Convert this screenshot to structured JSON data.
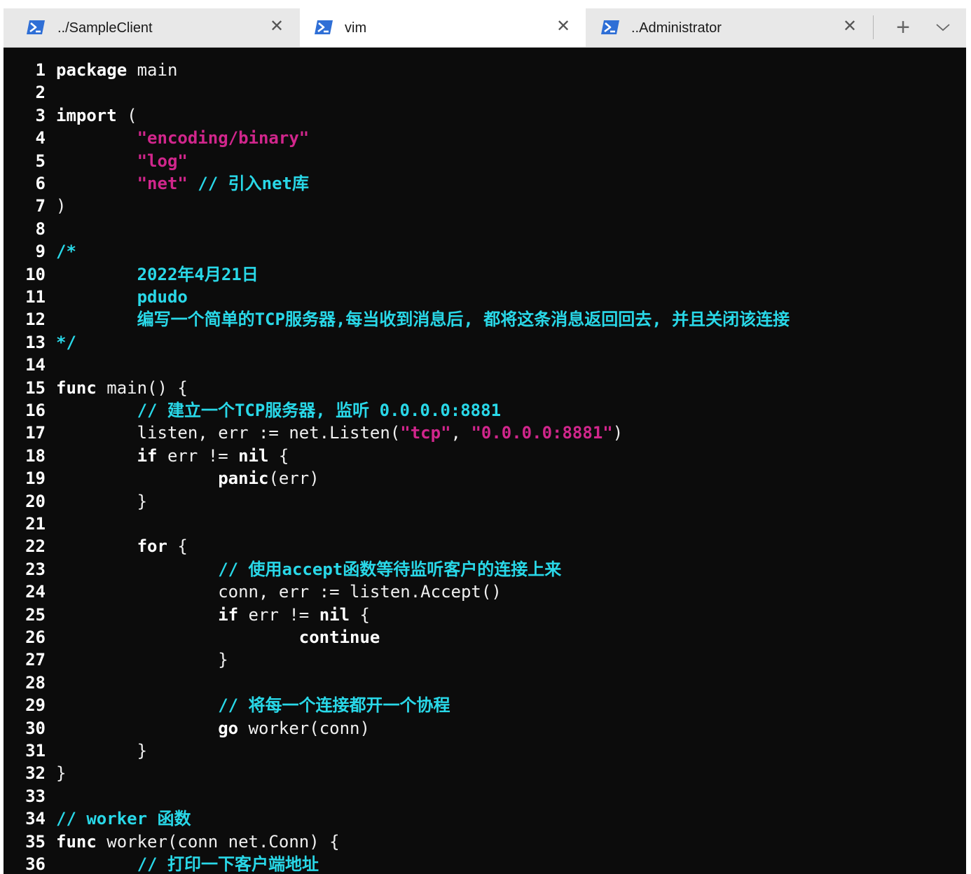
{
  "tabs": [
    {
      "title": "../SampleClient",
      "icon": "powershell-icon",
      "active": false
    },
    {
      "title": "vim",
      "icon": "powershell-icon",
      "active": true
    },
    {
      "title": "..Administrator",
      "icon": "powershell-icon",
      "active": false
    }
  ],
  "tab_close_glyph": "✕",
  "new_tab_glyph": "+",
  "colors": {
    "editor_bg": "#0c0c0c",
    "line_number": "#ffffff",
    "keyword": "#ffffff",
    "string": "#d1268c",
    "comment": "#29d8e8",
    "tab_icon": "#2f6fd6"
  },
  "lines": [
    {
      "n": "1",
      "tokens": [
        {
          "t": "package",
          "c": "kw"
        },
        {
          "t": " main",
          "c": "plain"
        }
      ]
    },
    {
      "n": "2",
      "tokens": []
    },
    {
      "n": "3",
      "tokens": [
        {
          "t": "import",
          "c": "kw"
        },
        {
          "t": " (",
          "c": "plain"
        }
      ]
    },
    {
      "n": "4",
      "tokens": [
        {
          "t": "        ",
          "c": "plain"
        },
        {
          "t": "\"encoding/binary\"",
          "c": "str"
        }
      ]
    },
    {
      "n": "5",
      "tokens": [
        {
          "t": "        ",
          "c": "plain"
        },
        {
          "t": "\"log\"",
          "c": "str"
        }
      ]
    },
    {
      "n": "6",
      "tokens": [
        {
          "t": "        ",
          "c": "plain"
        },
        {
          "t": "\"net\"",
          "c": "str"
        },
        {
          "t": " // 引入net库",
          "c": "com"
        }
      ]
    },
    {
      "n": "7",
      "tokens": [
        {
          "t": ")",
          "c": "plain"
        }
      ]
    },
    {
      "n": "8",
      "tokens": []
    },
    {
      "n": "9",
      "tokens": [
        {
          "t": "/*",
          "c": "com"
        }
      ]
    },
    {
      "n": "10",
      "tokens": [
        {
          "t": "        2022年4月21日",
          "c": "com"
        }
      ]
    },
    {
      "n": "11",
      "tokens": [
        {
          "t": "        pdudo",
          "c": "com"
        }
      ]
    },
    {
      "n": "12",
      "tokens": [
        {
          "t": "        编写一个简单的TCP服务器,每当收到消息后, 都将这条消息返回回去, 并且关闭该连接",
          "c": "com"
        }
      ]
    },
    {
      "n": "13",
      "tokens": [
        {
          "t": "*/",
          "c": "com"
        }
      ]
    },
    {
      "n": "14",
      "tokens": []
    },
    {
      "n": "15",
      "tokens": [
        {
          "t": "func",
          "c": "kw"
        },
        {
          "t": " main() {",
          "c": "plain"
        }
      ]
    },
    {
      "n": "16",
      "tokens": [
        {
          "t": "        // 建立一个TCP服务器, 监听 0.0.0.0:8881",
          "c": "com"
        }
      ]
    },
    {
      "n": "17",
      "tokens": [
        {
          "t": "        listen, err := net.Listen(",
          "c": "plain"
        },
        {
          "t": "\"tcp\"",
          "c": "str"
        },
        {
          "t": ", ",
          "c": "plain"
        },
        {
          "t": "\"0.0.0.0:8881\"",
          "c": "str"
        },
        {
          "t": ")",
          "c": "plain"
        }
      ]
    },
    {
      "n": "18",
      "tokens": [
        {
          "t": "        ",
          "c": "plain"
        },
        {
          "t": "if",
          "c": "kw"
        },
        {
          "t": " err != ",
          "c": "plain"
        },
        {
          "t": "nil",
          "c": "kw"
        },
        {
          "t": " {",
          "c": "plain"
        }
      ]
    },
    {
      "n": "19",
      "tokens": [
        {
          "t": "                ",
          "c": "plain"
        },
        {
          "t": "panic",
          "c": "kw"
        },
        {
          "t": "(err)",
          "c": "plain"
        }
      ]
    },
    {
      "n": "20",
      "tokens": [
        {
          "t": "        }",
          "c": "plain"
        }
      ]
    },
    {
      "n": "21",
      "tokens": []
    },
    {
      "n": "22",
      "tokens": [
        {
          "t": "        ",
          "c": "plain"
        },
        {
          "t": "for",
          "c": "kw"
        },
        {
          "t": " {",
          "c": "plain"
        }
      ]
    },
    {
      "n": "23",
      "tokens": [
        {
          "t": "                // 使用accept函数等待监听客户的连接上来",
          "c": "com"
        }
      ]
    },
    {
      "n": "24",
      "tokens": [
        {
          "t": "                conn, err := listen.Accept()",
          "c": "plain"
        }
      ]
    },
    {
      "n": "25",
      "tokens": [
        {
          "t": "                ",
          "c": "plain"
        },
        {
          "t": "if",
          "c": "kw"
        },
        {
          "t": " err != ",
          "c": "plain"
        },
        {
          "t": "nil",
          "c": "kw"
        },
        {
          "t": " {",
          "c": "plain"
        }
      ]
    },
    {
      "n": "26",
      "tokens": [
        {
          "t": "                        ",
          "c": "plain"
        },
        {
          "t": "continue",
          "c": "kw"
        }
      ]
    },
    {
      "n": "27",
      "tokens": [
        {
          "t": "                }",
          "c": "plain"
        }
      ]
    },
    {
      "n": "28",
      "tokens": []
    },
    {
      "n": "29",
      "tokens": [
        {
          "t": "                // 将每一个连接都开一个协程",
          "c": "com"
        }
      ]
    },
    {
      "n": "30",
      "tokens": [
        {
          "t": "                ",
          "c": "plain"
        },
        {
          "t": "go",
          "c": "kw"
        },
        {
          "t": " worker(conn)",
          "c": "plain"
        }
      ]
    },
    {
      "n": "31",
      "tokens": [
        {
          "t": "        }",
          "c": "plain"
        }
      ]
    },
    {
      "n": "32",
      "tokens": [
        {
          "t": "}",
          "c": "plain"
        }
      ]
    },
    {
      "n": "33",
      "tokens": []
    },
    {
      "n": "34",
      "tokens": [
        {
          "t": "// worker 函数",
          "c": "com"
        }
      ]
    },
    {
      "n": "35",
      "tokens": [
        {
          "t": "func",
          "c": "kw"
        },
        {
          "t": " worker(conn net.Conn) {",
          "c": "plain"
        }
      ]
    },
    {
      "n": "36",
      "tokens": [
        {
          "t": "        // 打印一下客户端地址",
          "c": "com"
        }
      ]
    }
  ]
}
